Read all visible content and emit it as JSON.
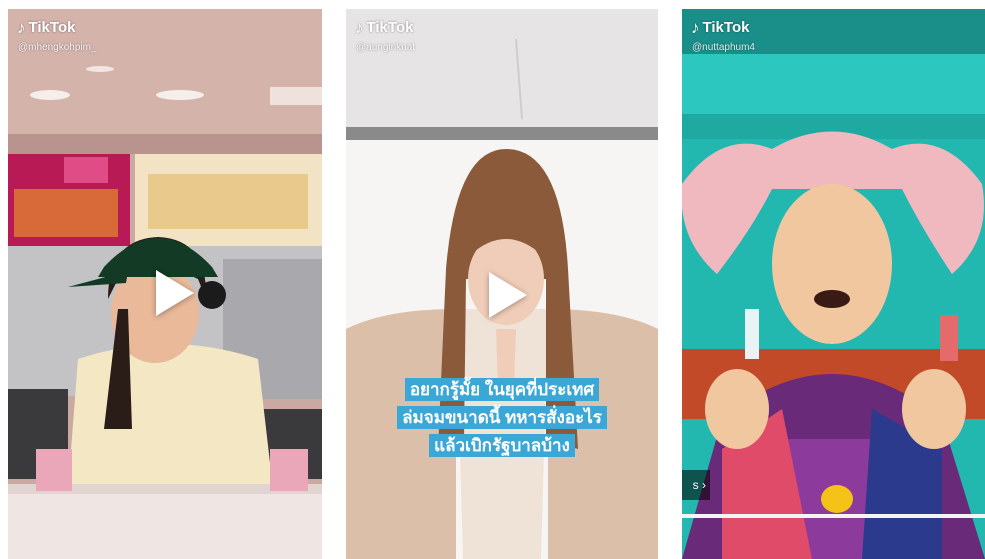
{
  "brand": {
    "name": "TikTok",
    "icon": "tiktok-note-icon"
  },
  "videos": [
    {
      "handle": "@mhengkohpim_",
      "caption": ""
    },
    {
      "handle": "@aunginknat",
      "caption": [
        "อยากรู้มั้ย ในยุคที่ประเทศ",
        "ล่มจมขนาดนี้ ทหารสั่งอะไร",
        "แล้วเบิกรัฐบาลบ้าง"
      ]
    },
    {
      "handle": "@nuttaphum4",
      "caption": "",
      "next_label": "s ›"
    }
  ],
  "colors": {
    "caption_bg": "#3aa7d6",
    "text": "#ffffff"
  }
}
